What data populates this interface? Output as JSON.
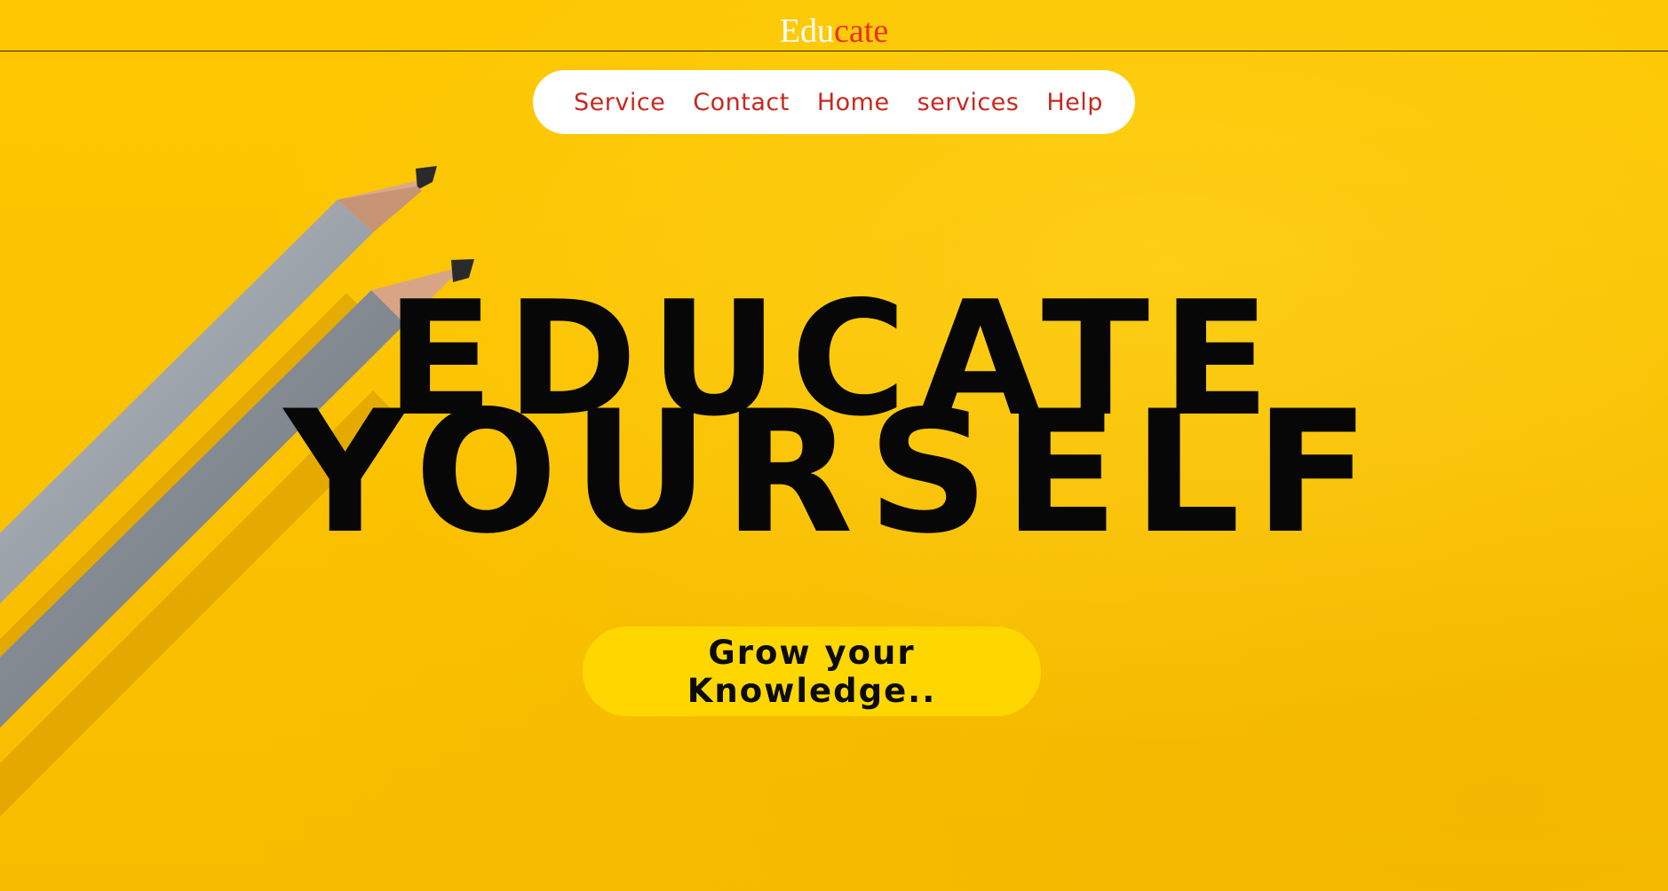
{
  "header": {
    "logo_part1": "Edu",
    "logo_part2": "cate"
  },
  "nav": {
    "items": [
      "Service",
      "Contact",
      "Home",
      "services",
      "Help"
    ]
  },
  "hero": {
    "line1": "EDUCATE",
    "line2": "YOURSELF",
    "cta_label": "Grow your Knowledge.."
  },
  "background": {
    "image": "yellow-paper-with-pencils",
    "color": "#fcc500"
  },
  "colors": {
    "accent": "#c8281e",
    "logo_highlight": "#e8321c",
    "cta_bg": "#ffd700"
  }
}
